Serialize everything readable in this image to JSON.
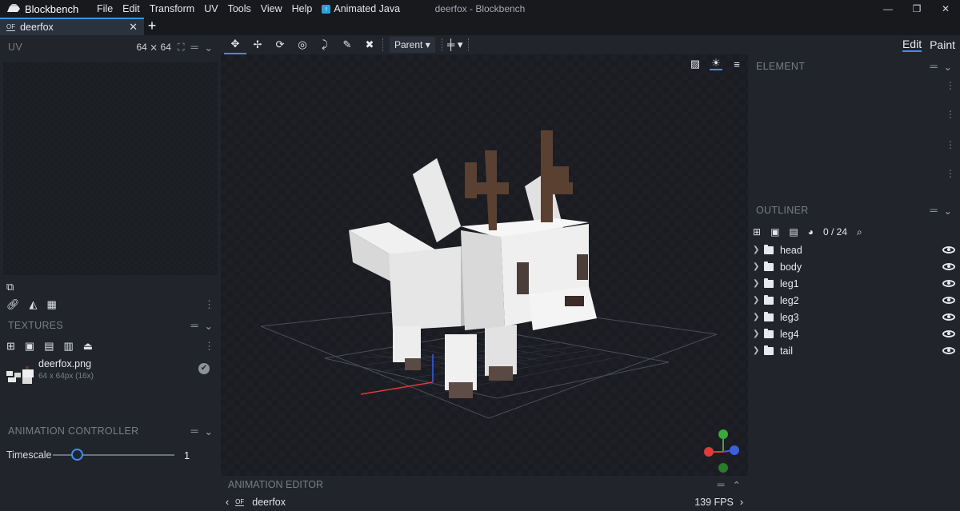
{
  "app": {
    "name": "Blockbench",
    "window_title": "deerfox - Blockbench"
  },
  "menu": [
    "File",
    "Edit",
    "Transform",
    "UV",
    "Tools",
    "View",
    "Help"
  ],
  "plugin_menu": "Animated Java",
  "tab": {
    "label": "deerfox",
    "close": "✕",
    "add": "+"
  },
  "uv_panel": {
    "title": "UV",
    "size": "64 ⨯ 64"
  },
  "textures_panel": {
    "title": "TEXTURES",
    "texture": {
      "name": "deerfox.png",
      "info": "64 x 64px (16x)"
    }
  },
  "animation_controller": {
    "title": "ANIMATION CONTROLLER",
    "timescale_label": "Timescale",
    "timescale_value": "1",
    "timescale_fraction": 0.2
  },
  "toolbar": {
    "pivot_select": "Parent"
  },
  "modes": {
    "edit": "Edit",
    "paint": "Paint"
  },
  "element_panel": {
    "title": "ELEMENT"
  },
  "outliner": {
    "title": "OUTLINER",
    "count": "0 / 24",
    "groups": [
      "head",
      "body",
      "leg1",
      "leg2",
      "leg3",
      "leg4",
      "tail"
    ]
  },
  "animation_editor": {
    "title": "ANIMATION EDITOR",
    "animation": "deerfox",
    "fps": "139 FPS"
  },
  "colors": {
    "accent": "#3e90ff",
    "x_axis": "#e03a3a",
    "y_axis": "#3aa83a",
    "z_axis": "#3a60e0"
  }
}
